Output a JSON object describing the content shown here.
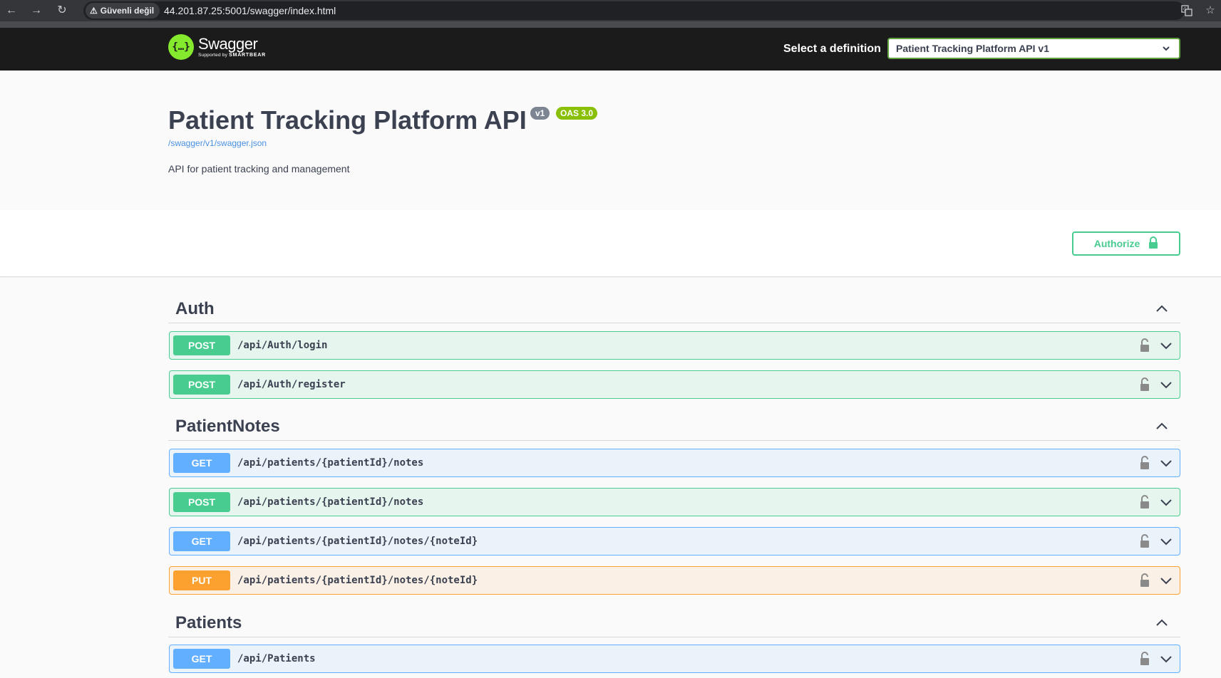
{
  "browser": {
    "security_label": "Güvenli değil",
    "url": "44.201.87.25:5001/swagger/index.html"
  },
  "topbar": {
    "logo_name": "Swagger",
    "logo_supported_by": "Supported by",
    "logo_smartbear": "SMARTBEAR",
    "definition_label": "Select a definition",
    "definition_selected": "Patient Tracking Platform API v1"
  },
  "info": {
    "title": "Patient Tracking Platform API",
    "version_badge": "v1",
    "oas_badge": "OAS 3.0",
    "spec_link": "/swagger/v1/swagger.json",
    "description": "API for patient tracking and management"
  },
  "auth": {
    "authorize_label": "Authorize"
  },
  "tags": [
    {
      "name": "Auth",
      "operations": [
        {
          "method": "POST",
          "path": "/api/Auth/login"
        },
        {
          "method": "POST",
          "path": "/api/Auth/register"
        }
      ]
    },
    {
      "name": "PatientNotes",
      "operations": [
        {
          "method": "GET",
          "path": "/api/patients/{patientId}/notes"
        },
        {
          "method": "POST",
          "path": "/api/patients/{patientId}/notes"
        },
        {
          "method": "GET",
          "path": "/api/patients/{patientId}/notes/{noteId}"
        },
        {
          "method": "PUT",
          "path": "/api/patients/{patientId}/notes/{noteId}"
        }
      ]
    },
    {
      "name": "Patients",
      "operations": [
        {
          "method": "GET",
          "path": "/api/Patients"
        }
      ]
    }
  ],
  "colors": {
    "post": "#49cc90",
    "get": "#61affe",
    "put": "#fca130",
    "swagger_green": "#85ea2d",
    "oas_badge": "#89bf04"
  },
  "icons": [
    "back-icon",
    "forward-icon",
    "reload-icon",
    "warning-icon",
    "translate-icon",
    "bookmark-star-icon",
    "lock-icon",
    "chevron-up-icon",
    "chevron-down-icon"
  ]
}
